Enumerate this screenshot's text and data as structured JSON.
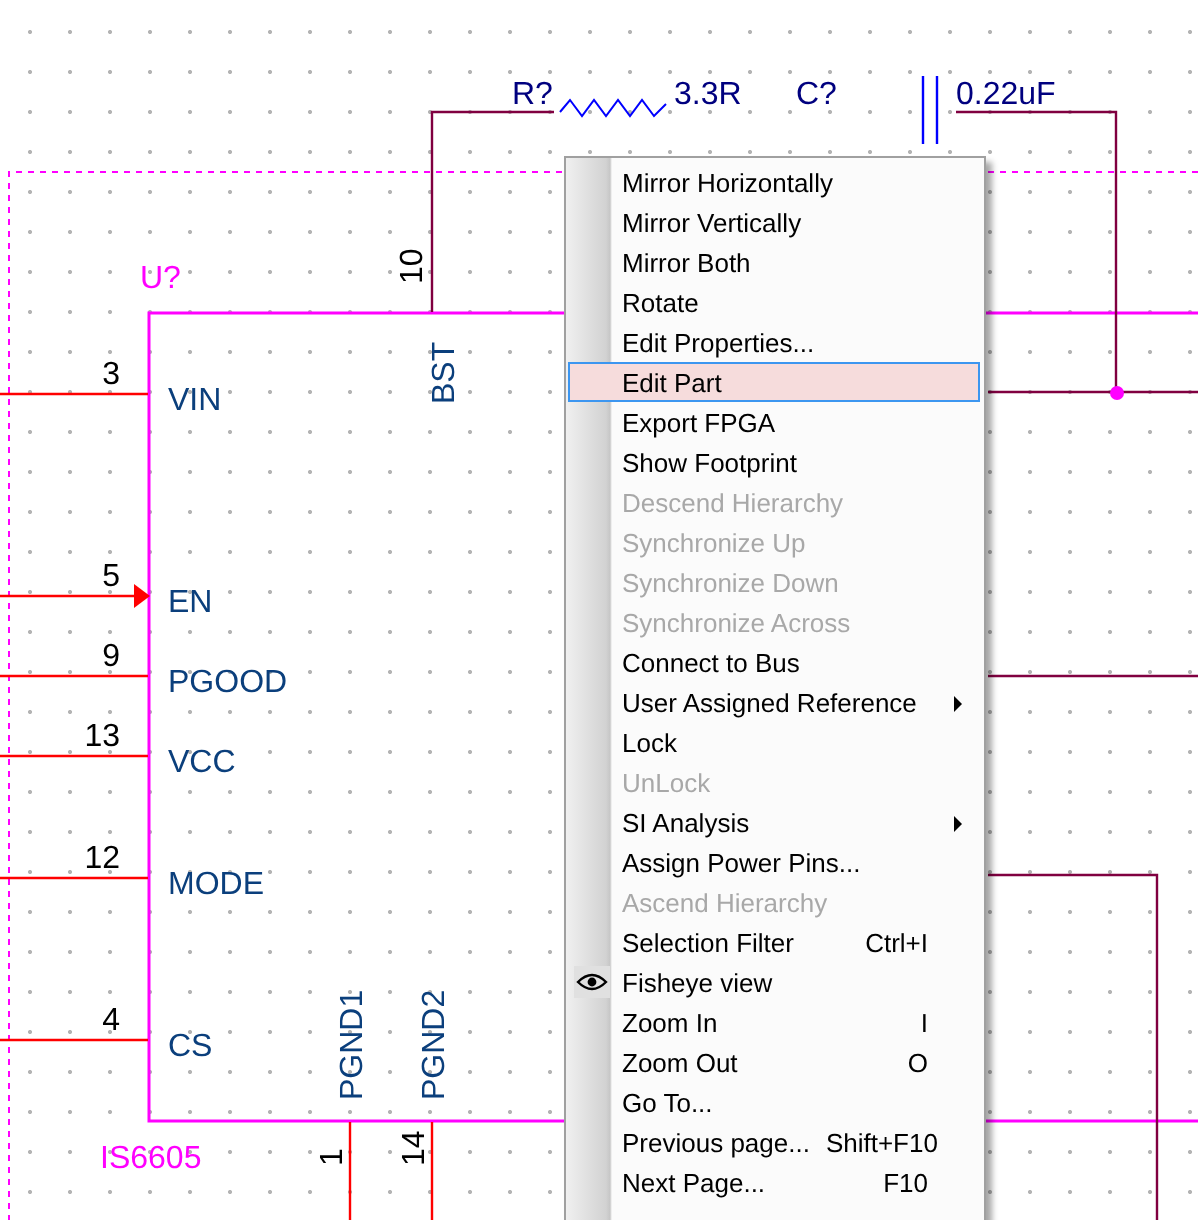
{
  "schematic": {
    "part": {
      "reference": "U?",
      "value": "IS6605",
      "left_pins": [
        {
          "number": "3",
          "name": "VIN",
          "kind": "passive"
        },
        {
          "number": "5",
          "name": "EN",
          "kind": "input"
        },
        {
          "number": "9",
          "name": "PGOOD",
          "kind": "passive"
        },
        {
          "number": "13",
          "name": "VCC",
          "kind": "passive"
        },
        {
          "number": "12",
          "name": "MODE",
          "kind": "passive"
        },
        {
          "number": "4",
          "name": "CS",
          "kind": "passive"
        }
      ],
      "top_pins": [
        {
          "number": "10",
          "name": "BST"
        }
      ],
      "bottom_pins": [
        {
          "number": "1",
          "name": "PGND1"
        },
        {
          "number": "14",
          "name": "PGND2"
        }
      ]
    },
    "resistor": {
      "reference": "R?",
      "value": "3.3R"
    },
    "capacitor": {
      "reference": "C?",
      "value": "0.22uF"
    }
  },
  "context_menu": {
    "items": [
      {
        "label": "Mirror Horizontally",
        "disabled": false,
        "selected": false
      },
      {
        "label": "Mirror Vertically",
        "disabled": false,
        "selected": false
      },
      {
        "label": "Mirror Both",
        "disabled": false,
        "selected": false
      },
      {
        "label": "Rotate",
        "disabled": false,
        "selected": false
      },
      {
        "label": "Edit Properties...",
        "disabled": false,
        "selected": false
      },
      {
        "label": "Edit Part",
        "disabled": false,
        "selected": true
      },
      {
        "label": "Export FPGA",
        "disabled": false,
        "selected": false
      },
      {
        "label": "Show Footprint",
        "disabled": false,
        "selected": false
      },
      {
        "label": "Descend Hierarchy",
        "disabled": true,
        "selected": false
      },
      {
        "label": "Synchronize Up",
        "disabled": true,
        "selected": false
      },
      {
        "label": "Synchronize Down",
        "disabled": true,
        "selected": false
      },
      {
        "label": "Synchronize Across",
        "disabled": true,
        "selected": false
      },
      {
        "label": "Connect to Bus",
        "disabled": false,
        "selected": false
      },
      {
        "label": "User Assigned Reference",
        "disabled": false,
        "selected": false,
        "submenu": true
      },
      {
        "label": "Lock",
        "disabled": false,
        "selected": false
      },
      {
        "label": "UnLock",
        "disabled": true,
        "selected": false
      },
      {
        "label": "SI Analysis",
        "disabled": false,
        "selected": false,
        "submenu": true
      },
      {
        "label": "Assign Power Pins...",
        "disabled": false,
        "selected": false
      },
      {
        "label": "Ascend Hierarchy",
        "disabled": true,
        "selected": false
      },
      {
        "label": "Selection Filter",
        "shortcut": "Ctrl+I",
        "disabled": false,
        "selected": false
      },
      {
        "label": "Fisheye view",
        "disabled": false,
        "selected": false,
        "checked": true
      },
      {
        "label": "Zoom In",
        "shortcut": "I",
        "disabled": false,
        "selected": false
      },
      {
        "label": "Zoom Out",
        "shortcut": "O",
        "disabled": false,
        "selected": false
      },
      {
        "label": "Go To...",
        "disabled": false,
        "selected": false
      },
      {
        "label": "Previous page...",
        "shortcut": "Shift+F10",
        "disabled": false,
        "selected": false
      },
      {
        "label": "Next Page...",
        "shortcut": "F10",
        "disabled": false,
        "selected": false
      }
    ]
  }
}
